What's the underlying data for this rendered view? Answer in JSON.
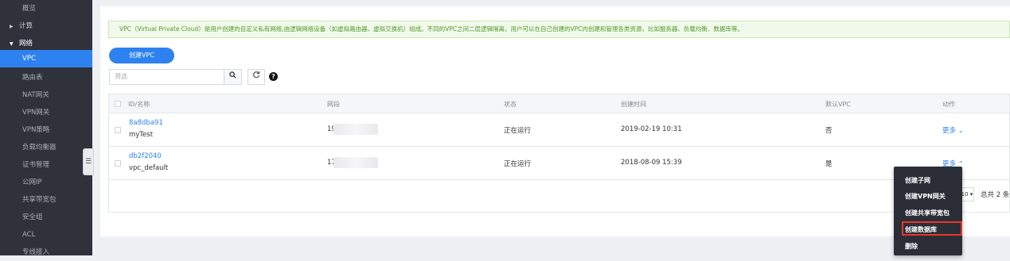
{
  "sidebar": {
    "items": [
      {
        "label": "概览",
        "type": "item"
      },
      {
        "label": "计算",
        "type": "group"
      },
      {
        "label": "网络",
        "type": "group-open"
      },
      {
        "label": "VPC",
        "type": "active"
      },
      {
        "label": "路由表",
        "type": "item"
      },
      {
        "label": "NAT网关",
        "type": "item"
      },
      {
        "label": "VPN网关",
        "type": "item"
      },
      {
        "label": "VPN策略",
        "type": "item"
      },
      {
        "label": "负载均衡器",
        "type": "item"
      },
      {
        "label": "证书管理",
        "type": "item"
      },
      {
        "label": "公网IP",
        "type": "item"
      },
      {
        "label": "共享带宽包",
        "type": "item"
      },
      {
        "label": "安全组",
        "type": "item"
      },
      {
        "label": "ACL",
        "type": "item"
      },
      {
        "label": "专线接入",
        "type": "item"
      }
    ]
  },
  "info_text": "VPC（Virtual Private Cloud）是用户创建的自定义私有网络,由逻辑网络设备（如虚拟路由器、虚拟交换机）组成。不同的VPC之间二层逻辑隔离，用户可以在自己创建的VPC内创建和管理各类资源，比如服务器、负载均衡、数据库等。",
  "create_button": "创建VPC",
  "filter_placeholder": "筛选",
  "table": {
    "headers": {
      "id": "ID/名称",
      "cidr": "网段",
      "status": "状态",
      "created": "创建时间",
      "default": "默认VPC",
      "action": "动作"
    },
    "rows": [
      {
        "id": "8a8dba91",
        "name": "myTest",
        "cidr": "19",
        "status": "正在运行",
        "created": "2019-02-19 10:31",
        "default": "否",
        "action": "更多 ⌄"
      },
      {
        "id": "db2f2040",
        "name": "vpc_default",
        "cidr": "17",
        "status": "正在运行",
        "created": "2018-08-09 15:39",
        "default": "是",
        "action": "更多 ⌃"
      }
    ]
  },
  "pagination": {
    "page_size": "10",
    "total": "总共 2 条"
  },
  "dropdown": {
    "items": [
      "创建子网",
      "创建VPN网关",
      "创建共享带宽包",
      "创建数据库",
      "删除"
    ],
    "highlighted": "创建数据库"
  }
}
